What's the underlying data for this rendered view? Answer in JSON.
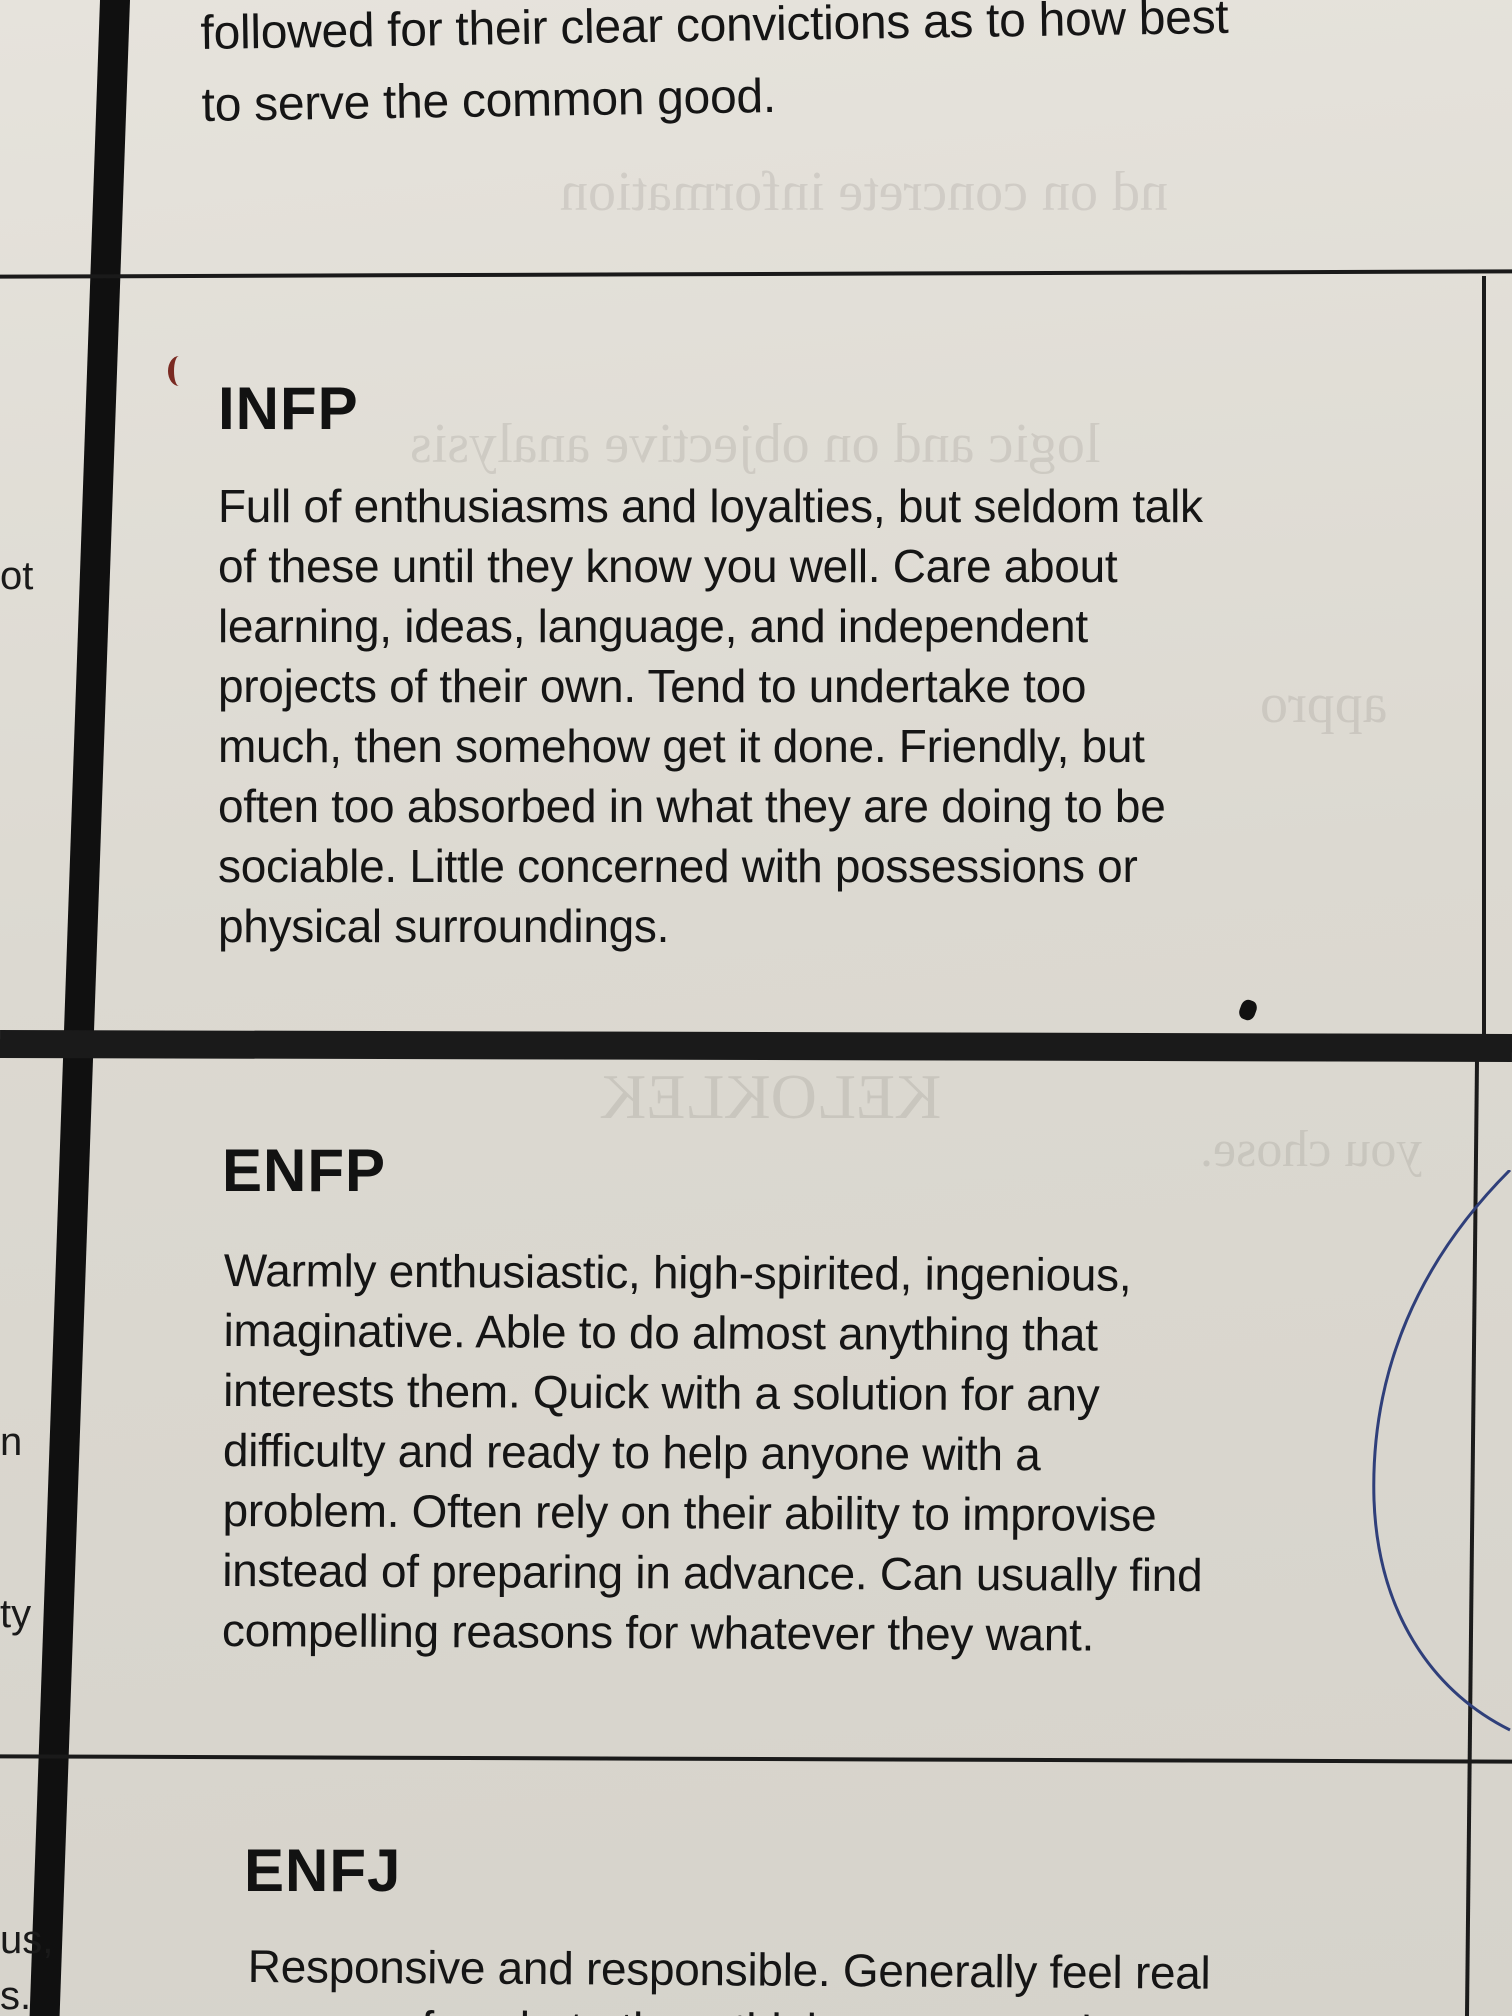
{
  "top_cell": {
    "lines": [
      "followed for their clear convictions as to how best",
      "to serve the common good."
    ]
  },
  "infp": {
    "title": "INFP",
    "lines": [
      "Full of enthusiasms and loyalties, but seldom talk",
      "of these until they know you well. Care about",
      "learning, ideas, language, and independent",
      "projects of their own. Tend to undertake too",
      "much, then somehow get it done. Friendly, but",
      "often too absorbed in what they are doing to be",
      "sociable. Little concerned with possessions or",
      "physical surroundings."
    ]
  },
  "enfp": {
    "title": "ENFP",
    "lines": [
      "Warmly enthusiastic, high-spirited, ingenious,",
      "imaginative. Able to do almost anything that",
      "interests them. Quick with a solution for any",
      "difficulty and ready to help anyone with a",
      "problem. Often rely on their ability to improvise",
      "instead of preparing in advance. Can usually find",
      "compelling reasons for whatever they want."
    ]
  },
  "enfj": {
    "title": "ENFJ",
    "lines": [
      "Responsive and responsible. Generally feel real",
      "concern for what others think or want, and try to"
    ]
  },
  "left_column_fragments": [
    "ot",
    "n",
    "ty",
    "us,",
    "s."
  ],
  "colors": {
    "ink": "#151515",
    "paper": "#dedbd3",
    "pen_blue": "#2f3f7a",
    "pen_red": "#7a2a22"
  }
}
